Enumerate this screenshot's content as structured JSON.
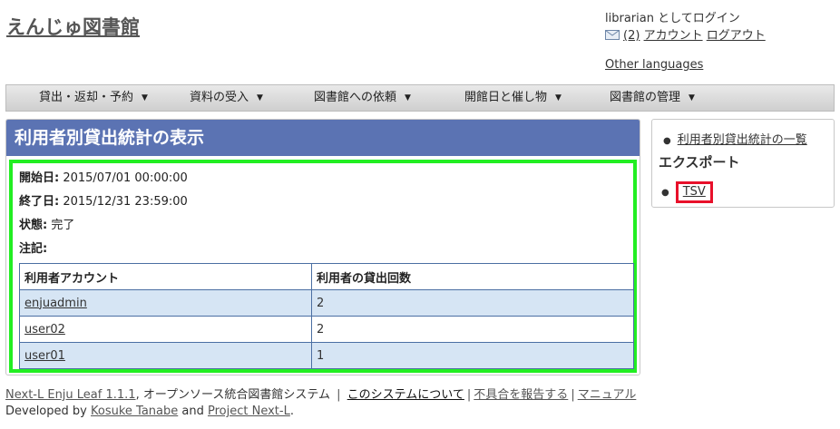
{
  "header": {
    "site_title": "えんじゅ図書館",
    "login_text": "librarian としてログイン",
    "message_count": "(2)",
    "account_link": "アカウント",
    "logout_link": "ログアウト",
    "other_languages": "Other languages"
  },
  "menu": {
    "items": [
      {
        "label": "貸出・返却・予約"
      },
      {
        "label": "資料の受入"
      },
      {
        "label": "図書館への依頼"
      },
      {
        "label": "開館日と催し物"
      },
      {
        "label": "図書館の管理"
      }
    ],
    "caret": "▼"
  },
  "main": {
    "title": "利用者別貸出統計の表示",
    "fields": [
      {
        "label": "開始日:",
        "value": "2015/07/01 00:00:00"
      },
      {
        "label": "終了日:",
        "value": "2015/12/31 23:59:00"
      },
      {
        "label": "状態:",
        "value": "完了"
      },
      {
        "label": "注記:",
        "value": ""
      }
    ],
    "table": {
      "headers": [
        "利用者アカウント",
        "利用者の貸出回数"
      ],
      "rows": [
        {
          "account": "enjuadmin",
          "count": "2"
        },
        {
          "account": "user02",
          "count": "2"
        },
        {
          "account": "user01",
          "count": "1"
        }
      ]
    }
  },
  "sidebar": {
    "list_link": "利用者別貸出統計の一覧",
    "export_heading": "エクスポート",
    "tsv_link": "TSV",
    "highlight_color": "#e8102a"
  },
  "footer": {
    "product": "Next-L Enju Leaf 1.1.1",
    "product_suffix": ", オープンソース統合図書館システム",
    "about": "このシステムについて",
    "report": "不具合を報告する",
    "manual": "マニュアル",
    "developed_by": "Developed by",
    "author": "Kosuke Tanabe",
    "and": "and",
    "project": "Project Next-L",
    "period": "."
  },
  "colors": {
    "title_bar": "#5b73b3",
    "content_border": "#22ee22",
    "table_stripe": "#d6e5f4"
  }
}
